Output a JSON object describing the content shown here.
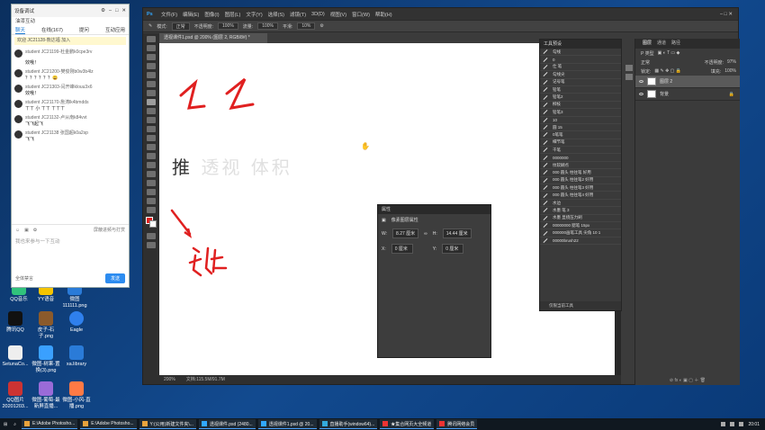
{
  "desktop": {
    "icons": [
      {
        "label": "QQ音乐",
        "color": "#31c27c"
      },
      {
        "label": "YY语音",
        "color": "#f5c400"
      },
      {
        "label": "微图 111111.png",
        "color": "#2a7bd8"
      },
      {
        "label": "腾讯QQ",
        "color": "#111111"
      },
      {
        "label": "皮子-石子.png",
        "color": "#8b5a2b"
      },
      {
        "label": "Eagle",
        "color": "#2f80ed"
      },
      {
        "label": "SetunaCo...",
        "color": "#eeeeee"
      },
      {
        "label": "微图-树果-置换(3).png",
        "color": "#3aa0ff"
      },
      {
        "label": "xa.library",
        "color": "#2a7bd8"
      },
      {
        "label": "QQ图片20201203...",
        "color": "#cc3333"
      },
      {
        "label": "微图-葡萄-最新屏直播...",
        "color": "#9a6bd8"
      },
      {
        "label": "微图-小风-直播.png",
        "color": "#ff7a45"
      }
    ]
  },
  "chat": {
    "title": "设备调试",
    "subtitle": "油漆互动",
    "tabs": [
      "聊天",
      "在线(167)",
      "提问",
      "互动应用"
    ],
    "notice": "欢迎 JC21128-熊达福 加入",
    "messages": [
      {
        "name": "student",
        "id": "JC21199-杜金鹏k0cpe3rv",
        "text": ""
      },
      {
        "name": "",
        "id": "",
        "text": "效哦！"
      },
      {
        "name": "student",
        "id": "JC21200-樊俊刚b0w3b4lz",
        "text": "？？？？？？😀"
      },
      {
        "name": "student",
        "id": "JC21303-闫开峰klouu3x6",
        "text": "效哦！"
      },
      {
        "name": "student",
        "id": "JC21170-詹涛lk4bmdds",
        "text": "ㄒㄒ 小 ㄒㄒ ㄒㄒㄒ"
      },
      {
        "name": "student",
        "id": "JC21132-卢从南k84vvt",
        "text": "飞飞起飞"
      },
      {
        "name": "student",
        "id": "JC21138 张国超k0a2sp",
        "text": "飞飞"
      }
    ],
    "toolbar_right": "屏蔽进频与打赏",
    "input_placeholder": "我也来参与一下互动",
    "mute_all": "全体禁言",
    "send": "发送"
  },
  "photoshop": {
    "menu": [
      "文件(F)",
      "编辑(E)",
      "图像(I)",
      "图层(L)",
      "文字(Y)",
      "选择(S)",
      "滤镜(T)",
      "3D(D)",
      "视图(V)",
      "窗口(W)",
      "帮助(H)"
    ],
    "options": {
      "mode_label": "模式:",
      "mode": "正常",
      "opacity_label": "不透明度:",
      "opacity": "100%",
      "flow_label": "流量:",
      "flow": "100%",
      "smooth_label": "平滑:",
      "smooth": "10%"
    },
    "doc_tab": "透视课件1.psd @ 200% (图层 2, RGB/8#) *",
    "canvas_text": {
      "dark": "推",
      "light": "透视  体积"
    },
    "status": {
      "zoom": "200%",
      "doc": "文档:115.5M/91.7M"
    },
    "tool_presets": {
      "title": "工具预设",
      "items": [
        "勾线",
        "0",
        "仕 笔",
        "勾线尖",
        "记号笔",
        "铅笔",
        "铅笔2",
        "柳枝",
        "铅笔3",
        "10",
        "圆 15",
        "0笔笔",
        "细节笔",
        "干笔",
        "0000000",
        "纹软糊点",
        "000 圆头 柱往笔 好用",
        "000 圆头 柱往笔2 好用",
        "000 圆头 柱往笔3 好用",
        "000 圆头 柱往笔4 好用",
        "水边",
        "水墨 笔 3",
        "水墨 显绕压力刷",
        "00000000 腮笔 15px",
        "000000画笔工具 尖角 10 1",
        "00000brush22"
      ],
      "footer": "仅限当前工具"
    },
    "properties": {
      "title": "属性",
      "subtitle": "像素图层属性",
      "w_label": "W:",
      "w": "8.27 厘米",
      "h_label": "H:",
      "h": "14.44 厘米",
      "x_label": "X:",
      "x": "0 厘米",
      "y_label": "Y:",
      "y": "0 厘米"
    },
    "layers_panel": {
      "tabs": [
        "图层",
        "通道",
        "路径"
      ],
      "filter": "P 类型",
      "blend": "正常",
      "opacity_label": "不透明度:",
      "opacity": "97%",
      "lock_label": "锁定:",
      "fill_label": "填充:",
      "fill": "100%",
      "layers": [
        {
          "name": "图层 2",
          "selected": true
        },
        {
          "name": "背景",
          "selected": false
        }
      ]
    }
  },
  "taskbar": {
    "items": [
      "E:\\Adobe Photosho...",
      "E:\\Adobe Photosho...",
      "Y:(公用)新建文件夹\\...",
      "透视课件.psd (2480...",
      "透视课件1.psd @ 20...",
      "直播助手(window64)...",
      "★集合网页大全频道",
      "腾讯网络会员"
    ],
    "clock": "20:01"
  }
}
